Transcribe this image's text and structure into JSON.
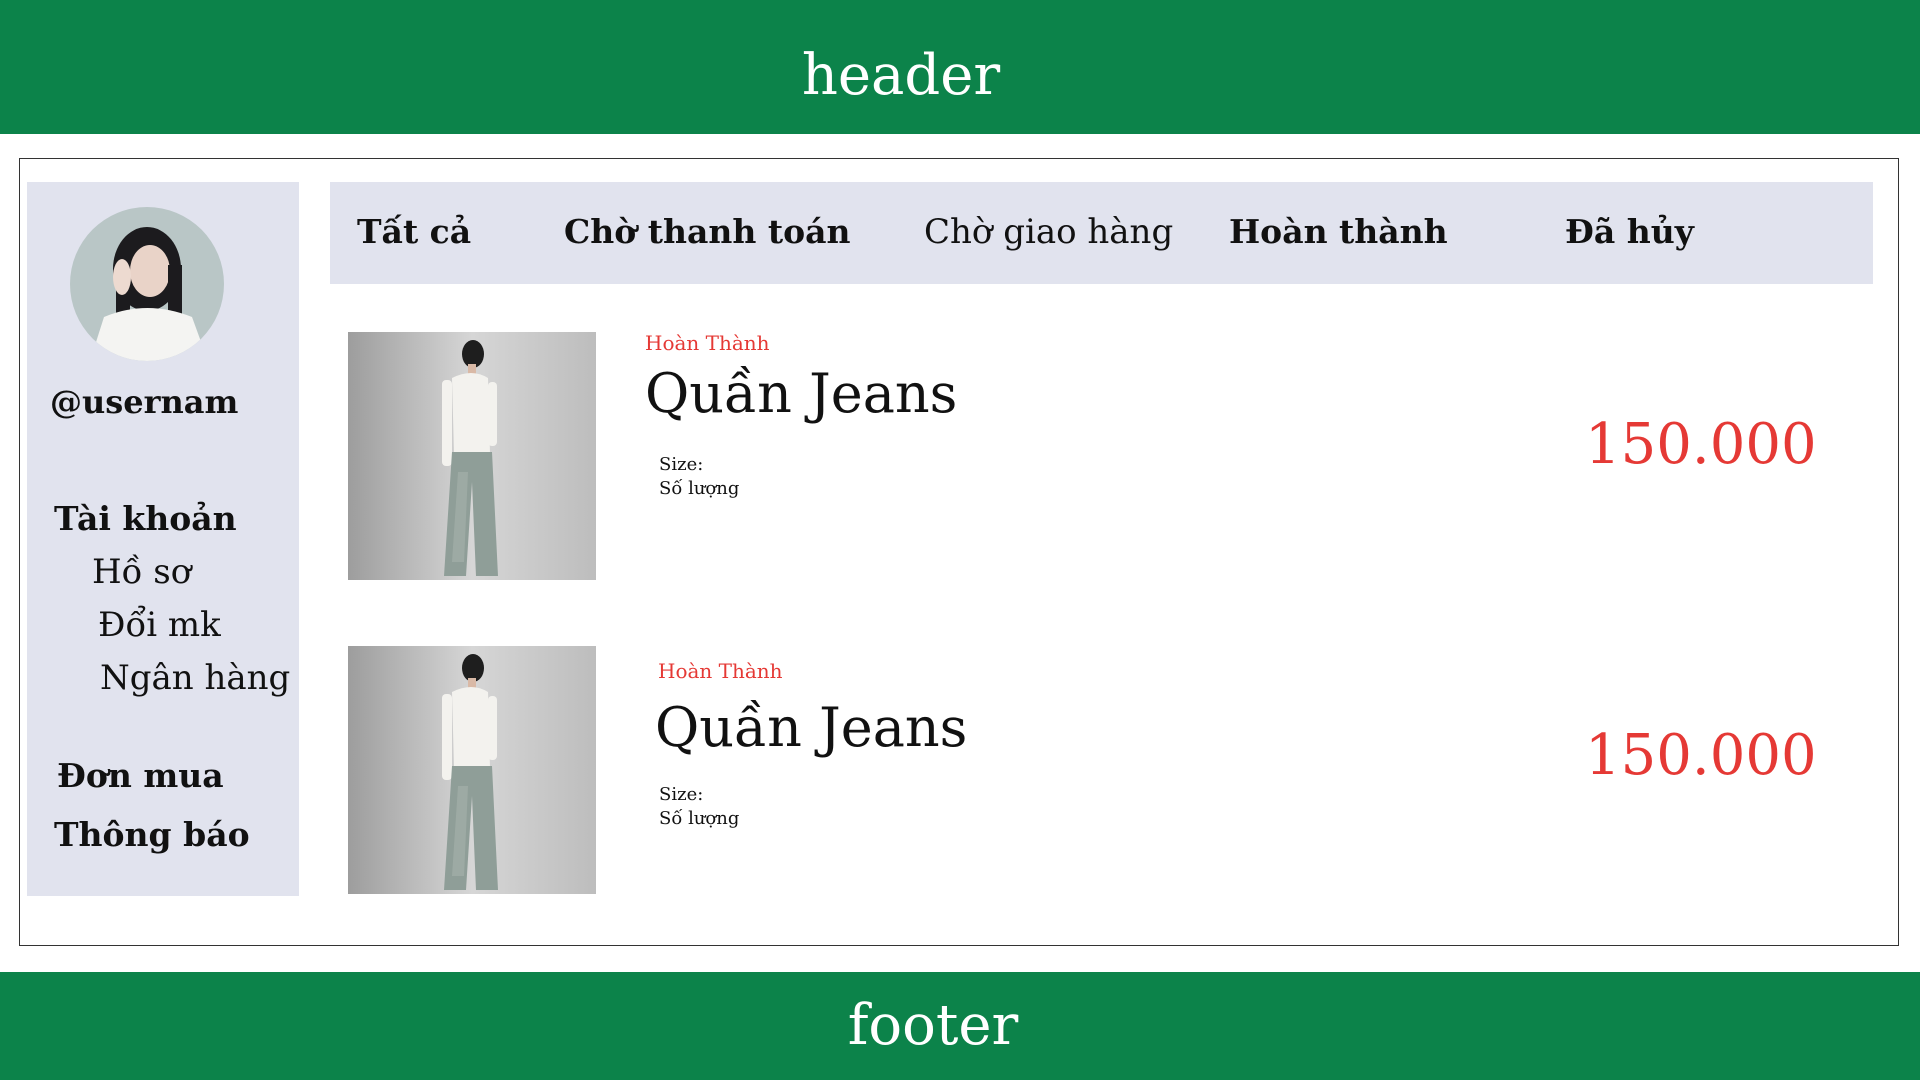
{
  "header": {
    "title": "header"
  },
  "footer": {
    "title": "footer"
  },
  "sidebar": {
    "username": "@usernam",
    "items": [
      {
        "label": "Tài khoản"
      },
      {
        "label": "Hồ sơ"
      },
      {
        "label": "Đổi mk"
      },
      {
        "label": "Ngân hàng"
      },
      {
        "label": "Đơn mua"
      },
      {
        "label": "Thông báo"
      }
    ]
  },
  "tabs": [
    {
      "label": "Tất cả"
    },
    {
      "label": "Chờ thanh toán"
    },
    {
      "label": "Chờ giao hàng"
    },
    {
      "label": "Hoàn thành"
    },
    {
      "label": "Đã hủy"
    }
  ],
  "orders": [
    {
      "status": "Hoàn Thành",
      "name": "Quần Jeans",
      "size_label": "Size:",
      "qty_label": "Số lượng",
      "price": "150.000"
    },
    {
      "status": "Hoàn Thành",
      "name": "Quần Jeans",
      "size_label": "Size:",
      "qty_label": "Số lượng",
      "price": "150.000"
    }
  ],
  "colors": {
    "brand_green": "#0c834a",
    "panel": "#e1e3ee",
    "accent_red": "#e53935"
  }
}
